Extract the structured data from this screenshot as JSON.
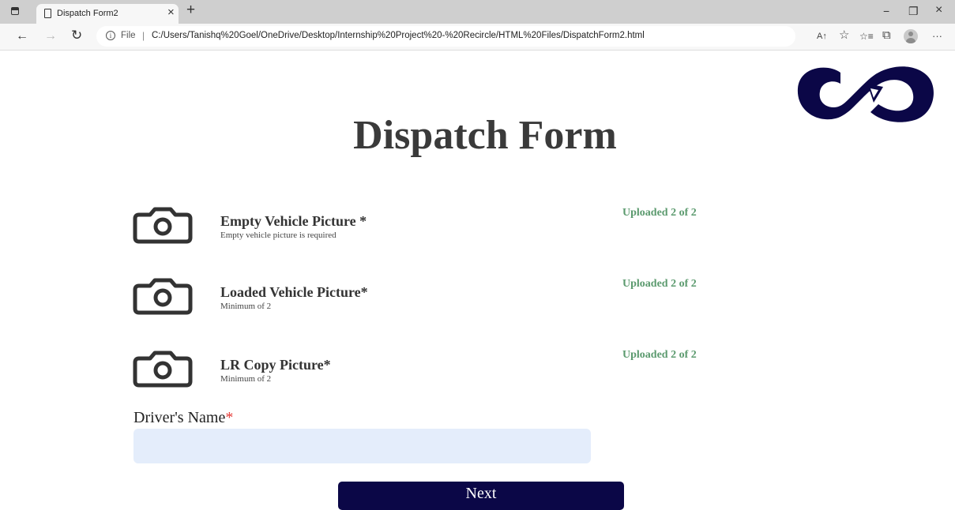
{
  "browser": {
    "tab_title": "Dispatch Form2",
    "tab_close": "×",
    "new_tab": "+",
    "window": {
      "minimize": "−",
      "restore": "❐",
      "close": "×"
    },
    "nav": {
      "back": "←",
      "forward": "→",
      "reload": "↻"
    },
    "url_scheme": "File",
    "url_separator": "|",
    "url": "C:/Users/Tanishq%20Goel/OneDrive/Desktop/Internship%20Project%20-%20Recircle/HTML%20Files/DispatchForm2.html",
    "tools": {
      "read_aloud": "A↑",
      "add_favorite": "☆",
      "favorites": "☆≡",
      "collections": "⧉",
      "more": "···"
    },
    "icons": [
      "tab-actions-icon",
      "page-icon",
      "info-icon",
      "read-aloud-icon",
      "add-favorite-icon",
      "favorites-icon",
      "collections-icon",
      "profile-icon",
      "more-icon"
    ]
  },
  "page": {
    "logo_icon": "recircle-logo-icon",
    "brand_color": "#0b0747",
    "title": "Dispatch Form",
    "upload_rows": [
      {
        "title": "Empty Vehicle Picture *",
        "subtitle": "Empty vehicle picture is required",
        "status": "Uploaded 2 of 2",
        "icon": "camera-icon"
      },
      {
        "title": "Loaded Vehicle Picture*",
        "subtitle": "Minimum of 2",
        "status": "Uploaded 2 of 2",
        "icon": "camera-icon"
      },
      {
        "title": "LR Copy Picture*",
        "subtitle": "Minimum of 2",
        "status": "Uploaded 2 of 2",
        "icon": "camera-icon"
      }
    ],
    "status_color": "#5b9a6e",
    "driver_label": "Driver's Name",
    "required_mark": "*",
    "driver_value": "",
    "driver_placeholder": "",
    "next_label": "Next"
  }
}
